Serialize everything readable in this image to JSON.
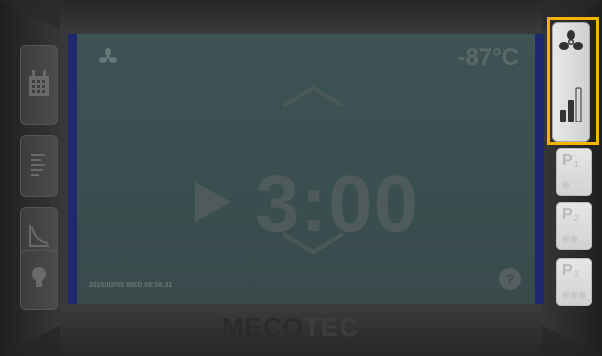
{
  "screen": {
    "temperature": "-87°C",
    "timer": "3:00",
    "datetime": "2025/02/05 WED 08:58:31",
    "help_label": "?"
  },
  "right_panel": {
    "presets": [
      {
        "label": "P",
        "sub": "1",
        "snow": "❄"
      },
      {
        "label": "P",
        "sub": "2",
        "snow": "❄❄"
      },
      {
        "label": "P",
        "sub": "3",
        "snow": "❄❄❄"
      }
    ]
  },
  "logo": {
    "part1": "MECO",
    "part2": "TEC"
  },
  "colors": {
    "highlight": "#f4b400",
    "screen_border": "#1f2a6e",
    "screen_bg": "#3d5354"
  },
  "icons": [
    "calendar-icon",
    "list-icon",
    "curve-chart-icon",
    "lightbulb-icon",
    "fan-icon",
    "signal-bars-icon",
    "play-icon",
    "chevron-up-icon",
    "chevron-down-icon",
    "help-icon"
  ]
}
